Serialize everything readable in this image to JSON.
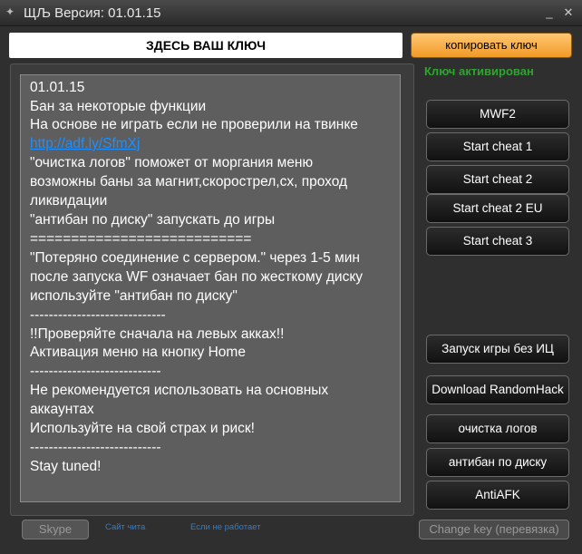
{
  "window": {
    "title": "ЩЉ Версия: 01.01.15",
    "icon": "app-icon",
    "minimize": "_",
    "close": "✕"
  },
  "key": {
    "placeholder_text": "ЗДЕСЬ ВАШ КЛЮЧ",
    "copy_label": "копировать ключ",
    "status": "Ключ активирован"
  },
  "info_lines": [
    "01.01.15",
    "Бан за некоторые функции",
    "На основе не играть если не проверили на твинке",
    "http://adf.ly/SfmXj",
    "\"очистка логов\" поможет от моргания меню",
    "возможны баны за магнит,скорострел,сх, проход",
    "ликвидации",
    "\"антибан по диску\" запускать до игры",
    "===========================",
    "\"Потеряно соединение с сервером.\" через 1-5 мин",
    "после запуска WF означает бан по жесткому диску",
    "используйте \"антибан по диску\"",
    "-----------------------------",
    "!!Проверяйте сначала на левых акках!!",
    "Активация меню на кнопку Home",
    "----------------------------",
    "Не рекомендуется использовать на основных",
    "аккаунтах",
    "Используйте на свой страх и риск!",
    "----------------------------",
    "Stay tuned!"
  ],
  "buttons_top": [
    "MWF2",
    "Start cheat 1",
    "Start cheat 2",
    "Start cheat 2 EU",
    "Start cheat 3"
  ],
  "buttons_bottom": [
    "Запуск игры без ИЦ",
    "Download RandomHack",
    "очистка логов",
    "антибан по диску",
    "AntiAFK"
  ],
  "footer": {
    "skype": "Skype",
    "link1": "Сайт чита",
    "link2": "Если не работает",
    "change_key": "Change key (перевязка)"
  }
}
